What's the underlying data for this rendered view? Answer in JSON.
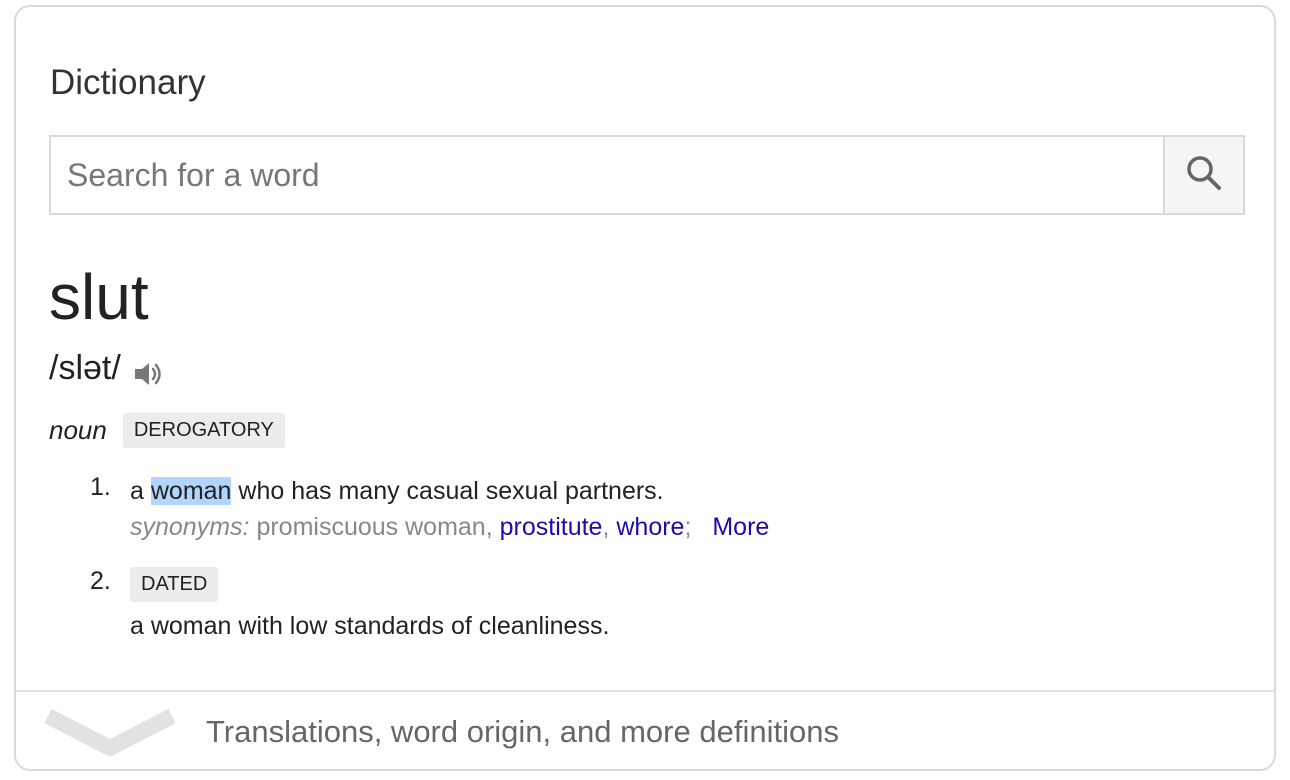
{
  "card": {
    "title": "Dictionary"
  },
  "search": {
    "placeholder": "Search for a word",
    "icon": "search-icon"
  },
  "entry": {
    "word": "slut",
    "pronunciation": "/slət/",
    "audio_icon": "speaker-icon",
    "part_of_speech": "noun",
    "pos_tag": "DEROGATORY",
    "senses": [
      {
        "number": "1.",
        "def_prefix": "a ",
        "def_highlight": "woman",
        "def_suffix": " who has many casual sexual partners.",
        "synonyms_label": "synonyms:",
        "synonym_plain": "promiscuous woman",
        "synonym_links": [
          "prostitute",
          "whore"
        ],
        "more_label": "More"
      },
      {
        "number": "2.",
        "tag": "DATED",
        "definition": "a woman with low standards of cleanliness."
      }
    ]
  },
  "footer": {
    "icon": "chevron-down-icon",
    "label": "Translations, word origin, and more definitions"
  },
  "colors": {
    "link": "#1a0dab",
    "highlight": "#b3d4fc",
    "tag_bg": "#ececec"
  }
}
